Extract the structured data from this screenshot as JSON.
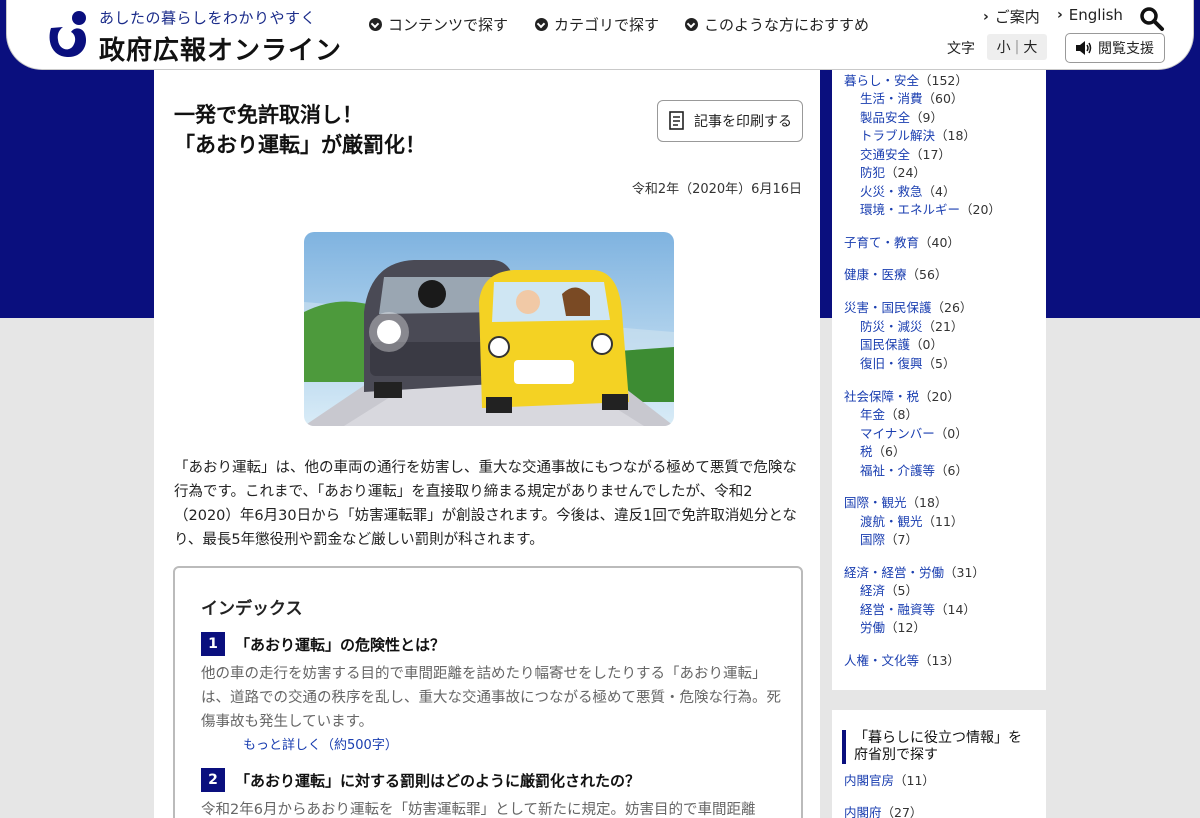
{
  "header": {
    "tagline": "あしたの暮らしをわかりやすく",
    "site_name": "政府広報オンライン",
    "nav": [
      "コンテンツで探す",
      "カテゴリで探す",
      "このような方におすすめ"
    ],
    "guide_link": "ご案内",
    "english_link": "English",
    "font_size_label": "文字",
    "font_small": "小",
    "font_large": "大",
    "accessibility_label": "閲覧支援",
    "brand_color": "#0a0f7e"
  },
  "article": {
    "title_line1": "一発で免許取消し！",
    "title_line2": "「あおり運転」が厳罰化！",
    "print_label": "記事を印刷する",
    "date": "令和2年（2020年）6月16日",
    "lead": "「あおり運転」は、他の車両の通行を妨害し、重大な交通事故にもつながる極めて悪質で危険な行為です。これまで、「あおり運転」を直接取り締まる規定がありませんでしたが、令和2（2020）年6月30日から「妨害運転罪」が創設されます。今後は、違反1回で免許取消処分となり、最長5年懲役刑や罰金など厳しい罰則が科されます。",
    "index": {
      "title": "インデックス",
      "items": [
        {
          "num": "1",
          "heading": "「あおり運転」の危険性とは？",
          "text": "他の車の走行を妨害する目的で車間距離を詰めたり幅寄せをしたりする「あおり運転」は、道路での交通の秩序を乱し、重大な交通事故につながる極めて悪質・危険な行為。死傷事故も発生しています。",
          "more": "もっと詳しく（約500字）"
        },
        {
          "num": "2",
          "heading": "「あおり運転」に対する罰則はどのように厳罰化されたの？",
          "text": "令和2年6月からあおり運転を「妨害運転罪」として新たに規定。妨害目的で車間距離"
        }
      ]
    }
  },
  "sidebar": {
    "categories": [
      {
        "label": "暮らし・安全",
        "count": "（152）",
        "subs": [
          {
            "label": "生活・消費",
            "count": "（60）"
          },
          {
            "label": "製品安全",
            "count": "（9）"
          },
          {
            "label": "トラブル解決",
            "count": "（18）"
          },
          {
            "label": "交通安全",
            "count": "（17）"
          },
          {
            "label": "防犯",
            "count": "（24）"
          },
          {
            "label": "火災・救急",
            "count": "（4）"
          },
          {
            "label": "環境・エネルギー",
            "count": "（20）"
          }
        ]
      },
      {
        "label": "子育て・教育",
        "count": "（40）",
        "subs": []
      },
      {
        "label": "健康・医療",
        "count": "（56）",
        "subs": []
      },
      {
        "label": "災害・国民保護",
        "count": "（26）",
        "subs": [
          {
            "label": "防災・減災",
            "count": "（21）"
          },
          {
            "label": "国民保護",
            "count": "（0）"
          },
          {
            "label": "復旧・復興",
            "count": "（5）"
          }
        ]
      },
      {
        "label": "社会保障・税",
        "count": "（20）",
        "subs": [
          {
            "label": "年金",
            "count": "（8）"
          },
          {
            "label": "マイナンバー",
            "count": "（0）"
          },
          {
            "label": "税",
            "count": "（6）"
          },
          {
            "label": "福祉・介護等",
            "count": "（6）"
          }
        ]
      },
      {
        "label": "国際・観光",
        "count": "（18）",
        "subs": [
          {
            "label": "渡航・観光",
            "count": "（11）"
          },
          {
            "label": "国際",
            "count": "（7）"
          }
        ]
      },
      {
        "label": "経済・経営・労働",
        "count": "（31）",
        "subs": [
          {
            "label": "経済",
            "count": "（5）"
          },
          {
            "label": "経営・融資等",
            "count": "（14）"
          },
          {
            "label": "労働",
            "count": "（12）"
          }
        ]
      },
      {
        "label": "人権・文化等",
        "count": "（13）",
        "subs": []
      }
    ],
    "ministry_box": {
      "title": "「暮らしに役立つ情報」を府省別で探す",
      "links": [
        {
          "label": "内閣官房",
          "count": "（11）"
        },
        {
          "label": "内閣府",
          "count": "（27）"
        }
      ]
    }
  }
}
